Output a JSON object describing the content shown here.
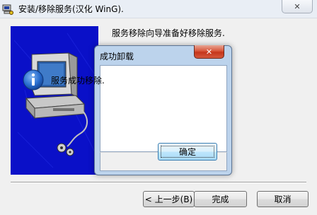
{
  "window": {
    "title": "安装/移除服务(汉化 WinG).",
    "close_glyph": "✕"
  },
  "wizard": {
    "message": "服务移除向导准备好移除服务.",
    "back_label": "< 上一步(B)",
    "finish_label": "完成",
    "cancel_label": "取消"
  },
  "dialog": {
    "title": "成功卸载",
    "message": "服务成功移除.",
    "ok_label": "确定",
    "close_glyph": "✕",
    "icon": "information-icon"
  },
  "colors": {
    "banner_blue": "#0a10c8",
    "dialog_frame": "#bcd3ec",
    "close_red": "#c5361b",
    "info_icon_blue": "#1f5fbf"
  }
}
